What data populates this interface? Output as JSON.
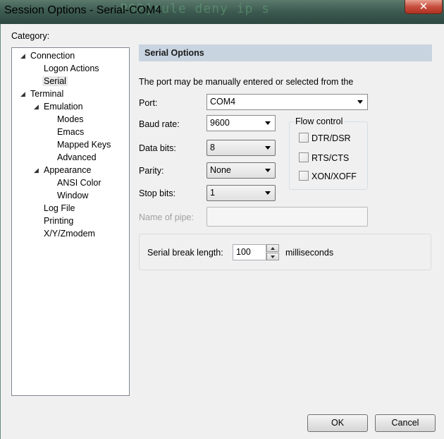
{
  "window": {
    "title": "Session Options - Serial-COM4",
    "background_terminal_text": "P02]rule deny ip s",
    "close_glyph": "✕"
  },
  "category": {
    "label": "Category:",
    "tree": [
      {
        "id": "connection",
        "label": "Connection",
        "arrow": "◢"
      },
      {
        "id": "logon-actions",
        "label": "Logon Actions"
      },
      {
        "id": "serial",
        "label": "Serial",
        "selected": true
      },
      {
        "id": "terminal",
        "label": "Terminal",
        "arrow": "◢"
      },
      {
        "id": "emulation",
        "label": "Emulation",
        "arrow": "◢"
      },
      {
        "id": "modes",
        "label": "Modes"
      },
      {
        "id": "emacs",
        "label": "Emacs"
      },
      {
        "id": "mapped-keys",
        "label": "Mapped Keys"
      },
      {
        "id": "advanced",
        "label": "Advanced"
      },
      {
        "id": "appearance",
        "label": "Appearance",
        "arrow": "◢"
      },
      {
        "id": "ansi-color",
        "label": "ANSI Color"
      },
      {
        "id": "window",
        "label": "Window"
      },
      {
        "id": "log-file",
        "label": "Log File"
      },
      {
        "id": "printing",
        "label": "Printing"
      },
      {
        "id": "xyzmodem",
        "label": "X/Y/Zmodem"
      }
    ]
  },
  "serial_options": {
    "header": "Serial Options",
    "description": "The port may be manually entered or selected from the",
    "port": {
      "label": "Port:",
      "value": "COM4"
    },
    "baud_rate": {
      "label": "Baud rate:",
      "value": "9600"
    },
    "data_bits": {
      "label": "Data bits:",
      "value": "8"
    },
    "parity": {
      "label": "Parity:",
      "value": "None"
    },
    "stop_bits": {
      "label": "Stop bits:",
      "value": "1"
    },
    "name_of_pipe": {
      "label": "Name of pipe:",
      "value": ""
    },
    "flow_control": {
      "label": "Flow control",
      "options": [
        {
          "label": "DTR/DSR",
          "checked": false
        },
        {
          "label": "RTS/CTS",
          "checked": false
        },
        {
          "label": "XON/XOFF",
          "checked": false
        }
      ]
    },
    "serial_break": {
      "label": "Serial break length:",
      "value": "100",
      "unit": "milliseconds"
    }
  },
  "buttons": {
    "ok": "OK",
    "cancel": "Cancel"
  },
  "colors": {
    "section_header_bg": "#c8d4e0",
    "close_button": "#c75040"
  }
}
